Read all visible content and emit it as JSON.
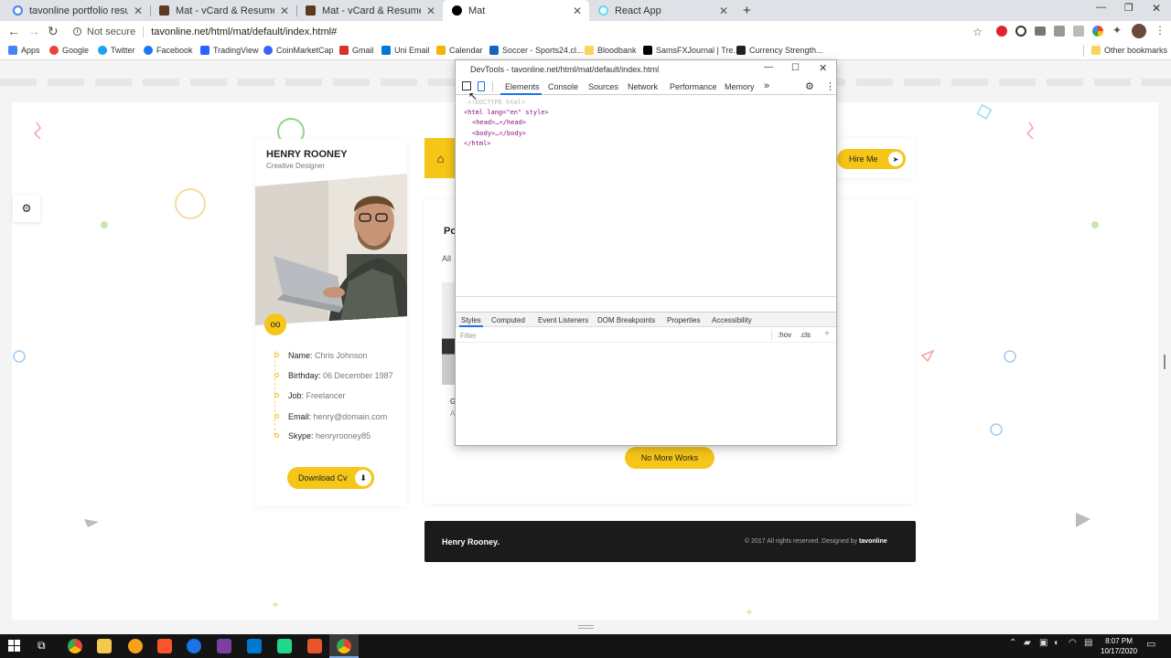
{
  "browser": {
    "tabs": [
      {
        "label": "tavonline portfolio resume - Go",
        "favicon_color": "#4285f4"
      },
      {
        "label": "Mat - vCard & Resume Template",
        "favicon_color": "#5a3b22"
      },
      {
        "label": "Mat - vCard & Resume Template",
        "favicon_color": "#5a3b22"
      },
      {
        "label": "Mat",
        "favicon_color": "#000000"
      },
      {
        "label": "React App",
        "favicon_color": "#61dafb"
      }
    ],
    "new_tab": "+",
    "security_label": "Not secure",
    "url": "tavonline.net/html/mat/default/index.html#",
    "bookmarks": [
      {
        "label": "Apps",
        "color": "#4285f4"
      },
      {
        "label": "Google",
        "color": "#ea4335"
      },
      {
        "label": "Twitter",
        "color": "#1da1f2"
      },
      {
        "label": "Facebook",
        "color": "#1877f2"
      },
      {
        "label": "TradingView",
        "color": "#2962ff"
      },
      {
        "label": "CoinMarketCap",
        "color": "#3861fb"
      },
      {
        "label": "Gmail",
        "color": "#d93025"
      },
      {
        "label": "Uni Email",
        "color": "#0078d4"
      },
      {
        "label": "Calendar",
        "color": "#f4b400"
      },
      {
        "label": "Soccer - Sports24.cl...",
        "color": "#1565c0"
      },
      {
        "label": "Bloodbank",
        "color": "#f9d55a"
      },
      {
        "label": "SamsFXJournal | Tre...",
        "color": "#000000"
      },
      {
        "label": "Currency Strength...",
        "color": "#222222"
      }
    ],
    "other_bookmarks": "Other bookmarks"
  },
  "site": {
    "profile": {
      "name": "HENRY ROONEY",
      "role": "Creative Designer",
      "info": [
        {
          "key": "Name:",
          "value": "Chris Johnson"
        },
        {
          "key": "Birthday:",
          "value": "06 December 1987"
        },
        {
          "key": "Job:",
          "value": "Freelancer"
        },
        {
          "key": "Email:",
          "value": "henry@domain.com"
        },
        {
          "key": "Skype:",
          "value": "henryrooney85"
        }
      ],
      "download_label": "Download Cv"
    },
    "hire_label": "Hire Me",
    "section_title_partial": "Po",
    "filter_partial": "All",
    "card_text_1": "G",
    "card_text_2": "A",
    "no_more_label": "No More Works",
    "footer_brand": "Henry Rooney.",
    "footer_copy": "© 2017 All rights reserved. Designed by ",
    "footer_credit": "tavonline",
    "accent_color": "#f5c518"
  },
  "devtools": {
    "title": "DevTools - tavonline.net/html/mat/default/index.html",
    "tabs": [
      "Elements",
      "Console",
      "Sources",
      "Network",
      "Performance",
      "Memory",
      "»"
    ],
    "active_tab": "Elements",
    "code": {
      "doctype": "<!DOCTYPE html>",
      "html_open": "<html lang=\"en\" style>",
      "head": "<head>…</head>",
      "body": "<body>…</body>",
      "html_close": "</html>"
    },
    "styles_tabs": [
      "Styles",
      "Computed",
      "Event Listeners",
      "DOM Breakpoints",
      "Properties",
      "Accessibility"
    ],
    "filter_placeholder": "Filter",
    "hov": ":hov",
    "cls": ".cls",
    "plus": "+"
  },
  "taskbar": {
    "time": "8:07 PM",
    "date": "10/17/2020"
  }
}
